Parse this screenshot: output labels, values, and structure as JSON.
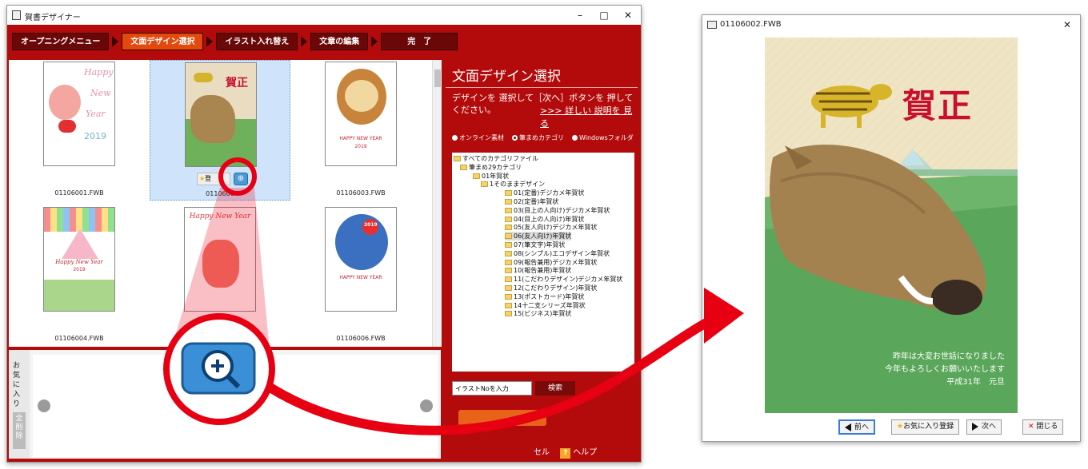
{
  "left_window": {
    "title": "賀書デザイナー",
    "steps": [
      "オープニングメニュー",
      "文面デザイン選択",
      "イラスト入れ替え",
      "文章の編集",
      "完　了"
    ],
    "cards": [
      {
        "file": "01106001.FWB",
        "text": [
          "Happy",
          "New",
          "Year",
          "2019"
        ]
      },
      {
        "file": "01106002.FWB",
        "text": [
          "賀正"
        ]
      },
      {
        "file": "01106003.FWB",
        "text": [
          "HAPPY NEW YEAR",
          "2019"
        ]
      },
      {
        "file": "01106004.FWB",
        "text": [
          "Happy New Year",
          "2019"
        ]
      },
      {
        "file": "",
        "text": [
          "Happy New Year"
        ]
      },
      {
        "file": "01106006.FWB",
        "text": [
          "HAPPY NEW YEAR",
          "2019"
        ]
      }
    ],
    "sel_card_buttons": {
      "fav": "登",
      "file_partial": "0110600"
    },
    "favorites": {
      "label": "お気に入り",
      "button": "全削除"
    },
    "panel": {
      "title": "文面デザイン選択",
      "desc": "デザインを 選択して［次へ］ボタンを 押してください。",
      "link": ">>> 詳しい 説明を 見る",
      "radios": [
        "オンライン素材",
        "筆まめカテゴリ",
        "Windowsフォルダ"
      ],
      "tree": [
        "すべてのカテゴリファイル",
        "筆まめ29カテゴリ",
        "01年賀状",
        "1そのままデザイン",
        "01(定番)デジカメ年賀状",
        "02(定番)年賀状",
        "03(目上の人向け)デジカメ年賀状",
        "04(目上の人向け)年賀状",
        "05(友人向け)デジカメ年賀状",
        "06(友人向け)年賀状",
        "07(筆文字)年賀状",
        "08(シンプル)エコデザイン年賀状",
        "09(報告兼用)デジカメ年賀状",
        "10(報告兼用)年賀状",
        "11(こだわりデザイン)デジカメ年賀状",
        "12(こだわりデザイン)年賀状",
        "13(ポストカード)年賀状",
        "14十二支シリーズ年賀状",
        "15(ビジネス)年賀状"
      ],
      "search_placeholder": "イラストNoを入力",
      "search_button": "検索",
      "cancel_partial": "セル",
      "help": "ヘルプ"
    }
  },
  "right_window": {
    "title": "01106002.FWB",
    "card_title": "賀正",
    "greeting": [
      "昨年は大変お世話になりました",
      "今年もよろしくお願いいたします",
      "平成31年　元旦"
    ],
    "buttons": [
      "前へ",
      "お気に入り登録",
      "次へ",
      "閉じる"
    ]
  },
  "colors": {
    "app_red": "#b30b0b",
    "active_step": "#e14a0c",
    "highlight_red": "#e60012"
  },
  "icons": [
    "zoom-icon",
    "star-icon",
    "close-icon",
    "minimize-icon",
    "maximize-icon"
  ]
}
